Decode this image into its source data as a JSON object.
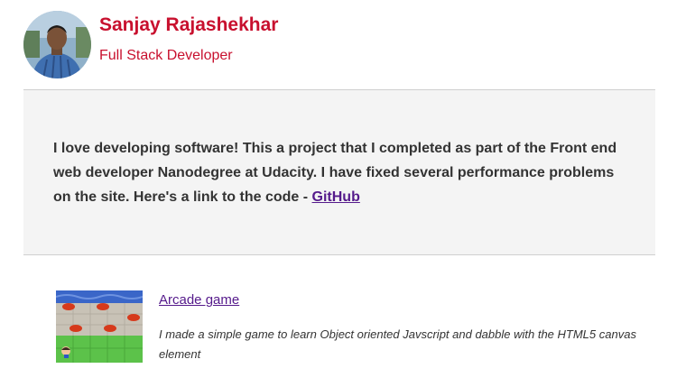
{
  "header": {
    "name": "Sanjay Rajashekhar",
    "role": "Full Stack Developer"
  },
  "about": {
    "text": "I love developing software! This a project that I completed as part of the Front end web developer Nanodegree at Udacity. I have fixed several performance problems on the site. Here's a link to the code - ",
    "link_label": "GitHub"
  },
  "projects": [
    {
      "title": "Arcade game",
      "description": "I made a simple game to learn Object oriented Javscript and dabble with the HTML5 canvas element"
    }
  ],
  "colors": {
    "name_red": "#c8102e",
    "link_purple": "#551a8b",
    "panel_bg": "#f4f4f4",
    "body_text": "#333333"
  }
}
